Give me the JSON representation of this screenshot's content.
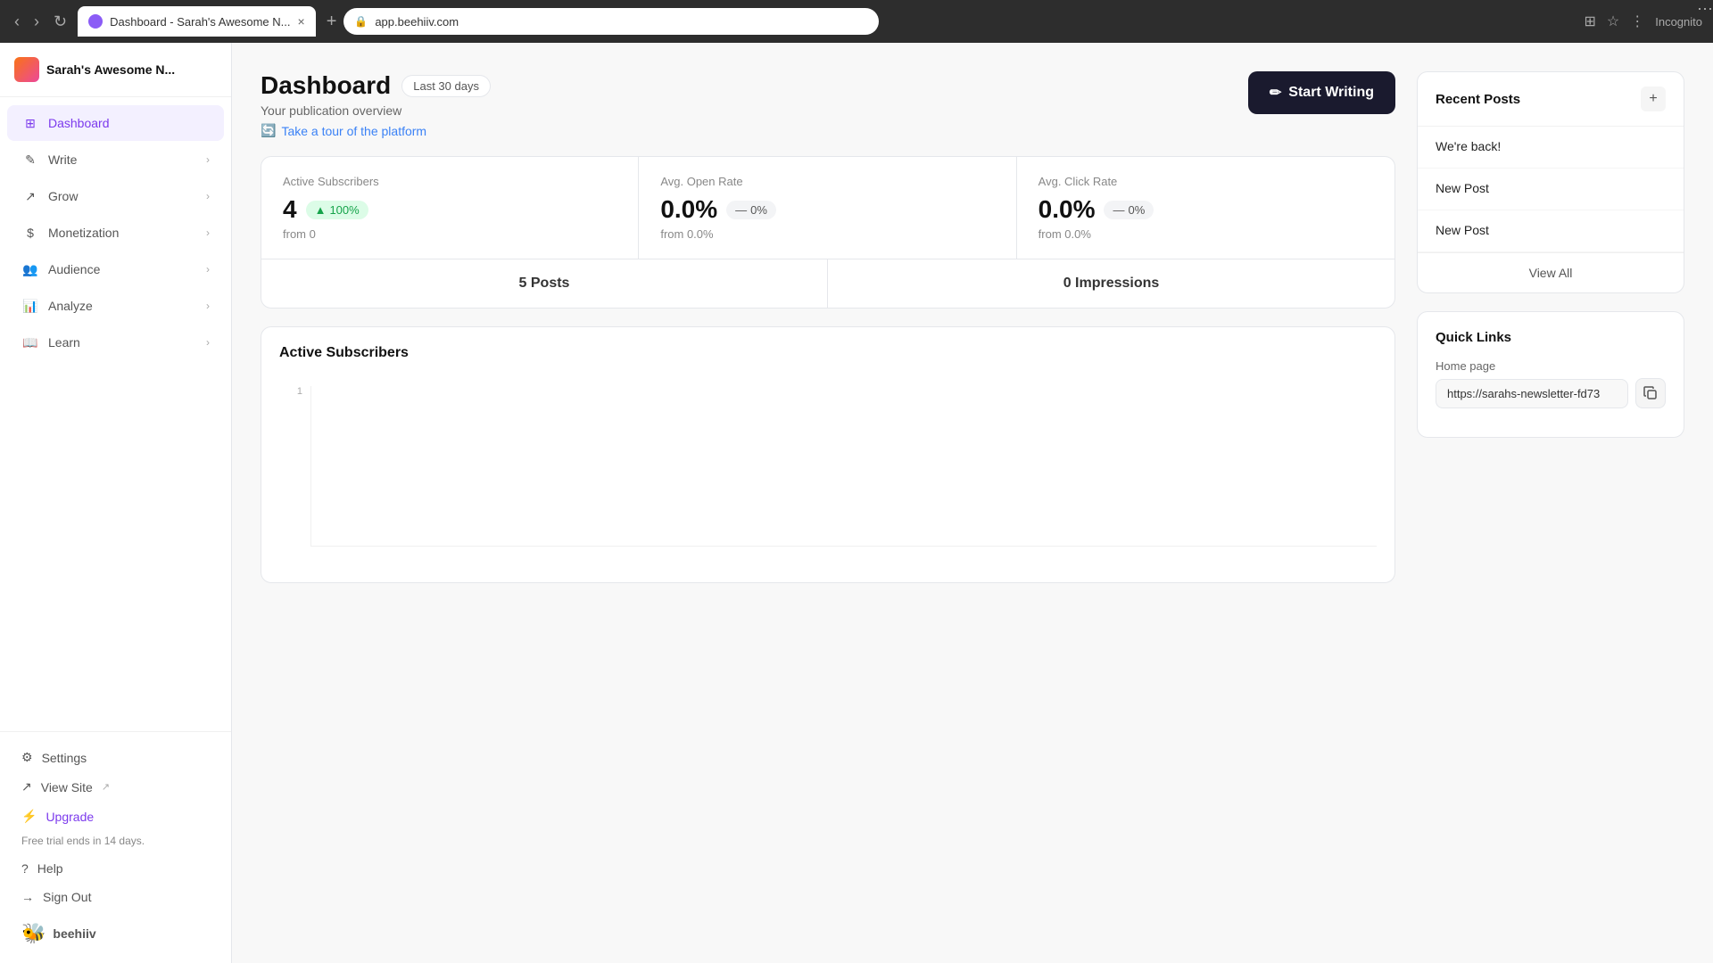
{
  "browser": {
    "tab_title": "Dashboard - Sarah's Awesome N...",
    "url": "app.beehiiv.com",
    "close_label": "×",
    "new_tab_label": "+"
  },
  "sidebar": {
    "publication_name": "Sarah's Awesome N...",
    "nav_items": [
      {
        "id": "dashboard",
        "label": "Dashboard",
        "icon": "grid",
        "active": true,
        "has_chevron": false
      },
      {
        "id": "write",
        "label": "Write",
        "icon": "edit",
        "active": false,
        "has_chevron": true
      },
      {
        "id": "grow",
        "label": "Grow",
        "icon": "trending-up",
        "active": false,
        "has_chevron": true
      },
      {
        "id": "monetization",
        "label": "Monetization",
        "icon": "dollar",
        "active": false,
        "has_chevron": true
      },
      {
        "id": "audience",
        "label": "Audience",
        "icon": "users",
        "active": false,
        "has_chevron": true
      },
      {
        "id": "analyze",
        "label": "Analyze",
        "icon": "bar-chart",
        "active": false,
        "has_chevron": true
      },
      {
        "id": "learn",
        "label": "Learn",
        "icon": "book",
        "active": false,
        "has_chevron": true
      }
    ],
    "footer_items": [
      {
        "id": "settings",
        "label": "Settings",
        "icon": "gear"
      },
      {
        "id": "view-site",
        "label": "View Site",
        "icon": "external-link"
      },
      {
        "id": "upgrade",
        "label": "Upgrade",
        "icon": "lightning",
        "highlight": true
      }
    ],
    "trial_notice": "Free trial ends in 14 days.",
    "footer_links": [
      {
        "id": "help",
        "label": "Help",
        "icon": "question"
      },
      {
        "id": "sign-out",
        "label": "Sign Out",
        "icon": "logout"
      }
    ],
    "brand_label": "beehiiv"
  },
  "dashboard": {
    "title": "Dashboard",
    "period_badge": "Last 30 days",
    "subtitle": "Your publication overview",
    "tour_label": "Take a tour of the platform",
    "start_writing_label": "Start Writing",
    "stats": {
      "active_subscribers": {
        "label": "Active Subscribers",
        "value": "4",
        "badge": "100%",
        "badge_type": "positive",
        "from_label": "from 0"
      },
      "avg_open_rate": {
        "label": "Avg. Open Rate",
        "value": "0.0%",
        "badge": "0%",
        "badge_type": "neutral",
        "from_label": "from 0.0%"
      },
      "avg_click_rate": {
        "label": "Avg. Click Rate",
        "value": "0.0%",
        "badge": "0%",
        "badge_type": "neutral",
        "from_label": "from 0.0%"
      }
    },
    "posts_count": "5 Posts",
    "impressions_count": "0 Impressions",
    "chart": {
      "title": "Active Subscribers",
      "y_labels": [
        "1",
        ""
      ],
      "x_label_count": 0
    }
  },
  "recent_posts": {
    "title": "Recent Posts",
    "add_label": "+",
    "posts": [
      {
        "name": "We're back!"
      },
      {
        "name": "New Post"
      },
      {
        "name": "New Post"
      }
    ],
    "view_all_label": "View All"
  },
  "quick_links": {
    "title": "Quick Links",
    "home_page": {
      "label": "Home page",
      "url": "https://sarahs-newsletter-fd73"
    }
  }
}
